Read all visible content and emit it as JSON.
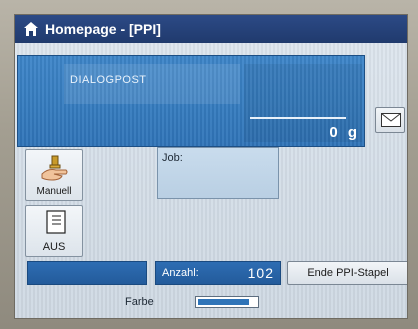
{
  "titlebar": {
    "home_icon": "home-icon",
    "title": "Homepage - [PPI]"
  },
  "main": {
    "dialog_label": "DIALOGPOST",
    "weight": "0 g",
    "mail_icon": "envelope-icon"
  },
  "side": {
    "manual_label": "Manuell",
    "manual_icon": "hand-with-scale-icon",
    "aus_label": "AUS",
    "aus_icon": "document-icon"
  },
  "job": {
    "label": "Job:"
  },
  "bottom": {
    "count_label": "Anzahl:",
    "count_value": "102",
    "end_button": "Ende PPI-Stapel",
    "farbe_label": "Farbe",
    "farbe_level_fraction": 0.88
  },
  "colors": {
    "titlebar": "#203a6d",
    "panel_blue": "#2f74b8",
    "screen_bg": "#d3dde7"
  }
}
